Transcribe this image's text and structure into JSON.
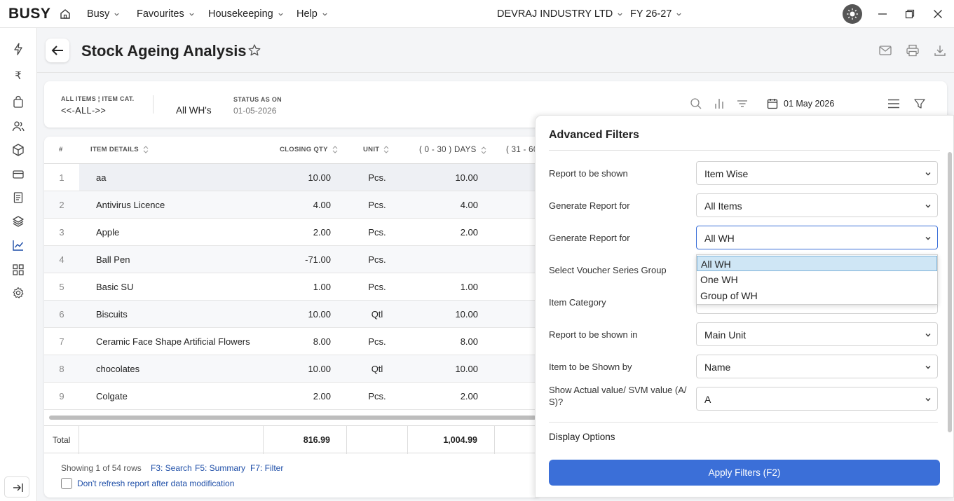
{
  "app": {
    "logo": "BUSY",
    "menus": [
      "Busy",
      "Favourites",
      "Housekeeping",
      "Help"
    ],
    "company": "DEVRAJ INDUSTRY LTD",
    "fy": "FY 26-27"
  },
  "page": {
    "title": "Stock Ageing Analysis"
  },
  "filters": {
    "items_caption": "ALL ITEMS ¦ ITEM CAT.",
    "items_value": "<<-ALL->>",
    "wh_value": "All WH's",
    "status_caption": "STATUS AS ON",
    "status_value": "01-05-2026",
    "date": "01 May 2026"
  },
  "table": {
    "headers": {
      "num": "#",
      "item": "ITEM DETAILS",
      "qty": "CLOSING QTY",
      "unit": "UNIT",
      "d030": "( 0 - 30 ) DAYS",
      "d3160": "( 31 - 60"
    },
    "rows": [
      {
        "n": "1",
        "item": "aa",
        "qty": "10.00",
        "unit": "Pcs.",
        "d": "10.00"
      },
      {
        "n": "2",
        "item": "Antivirus Licence",
        "qty": "4.00",
        "unit": "Pcs.",
        "d": "4.00"
      },
      {
        "n": "3",
        "item": "Apple",
        "qty": "2.00",
        "unit": "Pcs.",
        "d": "2.00"
      },
      {
        "n": "4",
        "item": "Ball Pen",
        "qty": "-71.00",
        "unit": "Pcs.",
        "d": ""
      },
      {
        "n": "5",
        "item": "Basic SU",
        "qty": "1.00",
        "unit": "Pcs.",
        "d": "1.00"
      },
      {
        "n": "6",
        "item": "Biscuits",
        "qty": "10.00",
        "unit": "Qtl",
        "d": "10.00"
      },
      {
        "n": "7",
        "item": "Ceramic Face Shape Artificial Flowers",
        "qty": "8.00",
        "unit": "Pcs.",
        "d": "8.00"
      },
      {
        "n": "8",
        "item": "chocolates",
        "qty": "10.00",
        "unit": "Qtl",
        "d": "10.00"
      },
      {
        "n": "9",
        "item": "Colgate",
        "qty": "2.00",
        "unit": "Pcs.",
        "d": "2.00"
      }
    ],
    "total_label": "Total",
    "total_qty": "816.99",
    "total_d": "1,004.99"
  },
  "footer": {
    "showing": "Showing 1 of 54 rows",
    "f3": "F3: Search",
    "f5": "F5: Summary",
    "f7": "F7: Filter",
    "refresh": "Don't refresh report after data modification"
  },
  "panel": {
    "title": "Advanced Filters",
    "fields": [
      {
        "label": "Report to be shown",
        "value": "Item Wise"
      },
      {
        "label": "Generate Report for",
        "value": "All Items"
      },
      {
        "label": "Generate Report for",
        "value": "All WH"
      },
      {
        "label": "Select Voucher Series Group",
        "value": ""
      },
      {
        "label": "Item Category",
        "value": ""
      },
      {
        "label": "Report to be shown in",
        "value": "Main Unit"
      },
      {
        "label": "Item to be Shown by",
        "value": "Name"
      },
      {
        "label": "Show Actual value/ SVM value (A/ S)?",
        "value": "A"
      }
    ],
    "dropdown": [
      "All WH",
      "One WH",
      "Group of WH"
    ],
    "display_options": "Display Options",
    "apply": "Apply Filters (F2)"
  },
  "colors": {
    "accent": "#3b6fd8",
    "link": "#1f4fa8",
    "selected": "#cfe6f5"
  }
}
